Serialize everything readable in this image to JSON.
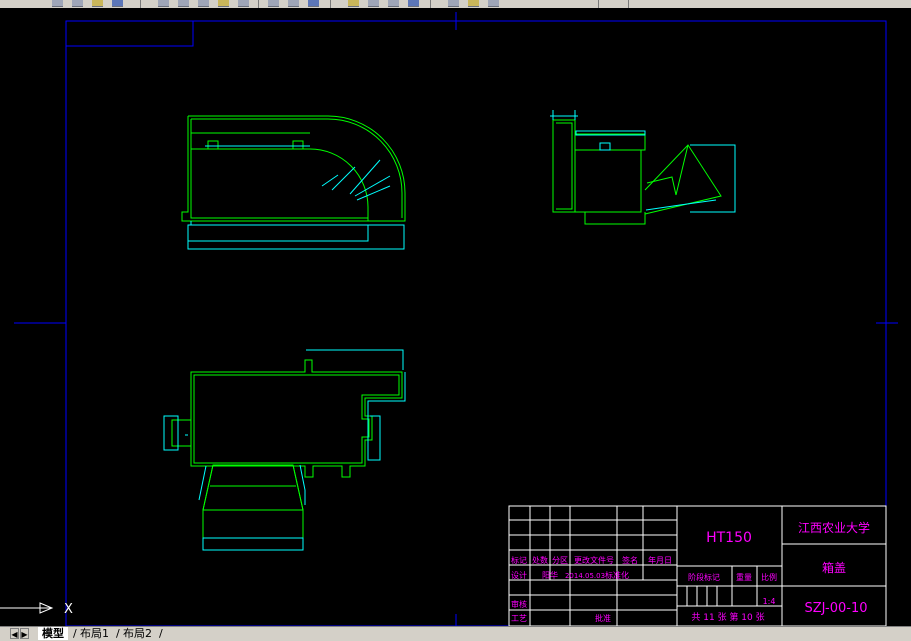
{
  "toolbar": {
    "icons": [
      "zoom-icon",
      "pan-icon",
      "redo-icon",
      "undo-icon",
      "properties-icon",
      "paste-icon",
      "match-icon",
      "cut-icon",
      "layer-icon",
      "zoom-window-icon",
      "zoom-prev-icon",
      "realtime-zoom-icon",
      "zoom-extents-icon",
      "named-views-icon",
      "table-icon",
      "calculator-icon",
      "help-icon",
      "adcenter-icon",
      "toolpalette-icon"
    ]
  },
  "title_block": {
    "material": "HT150",
    "school": "江西农业大学",
    "part_name": "箱盖",
    "drawing_number": "SZJ-00-10",
    "scale": "1:4",
    "sheet_info": "共 11 张 第 10 张",
    "header_labels": [
      "标记",
      "处数",
      "分区",
      "更改文件号",
      "签名",
      "年月日"
    ],
    "row_design": [
      "设计",
      "阳华",
      "2014.05.03",
      "标准化"
    ],
    "label_review": "审核",
    "label_process": "工艺",
    "label_approve": "批准",
    "stage_labels": [
      "阶段标记",
      "重量",
      "比例"
    ]
  },
  "ucs": {
    "axis_label": "X"
  },
  "tabs": {
    "nav_buttons": [
      "◀",
      "▶"
    ],
    "items": [
      {
        "label": "模型",
        "active": true
      },
      {
        "label": "布局1",
        "active": false
      },
      {
        "label": "布局2",
        "active": false
      }
    ]
  },
  "colors": {
    "background": "#000000",
    "border": "#0000ff",
    "part_outline": "#00ff00",
    "dimension": "#00ffff",
    "text": "#ff00ff",
    "title_lines": "#ffffff"
  }
}
